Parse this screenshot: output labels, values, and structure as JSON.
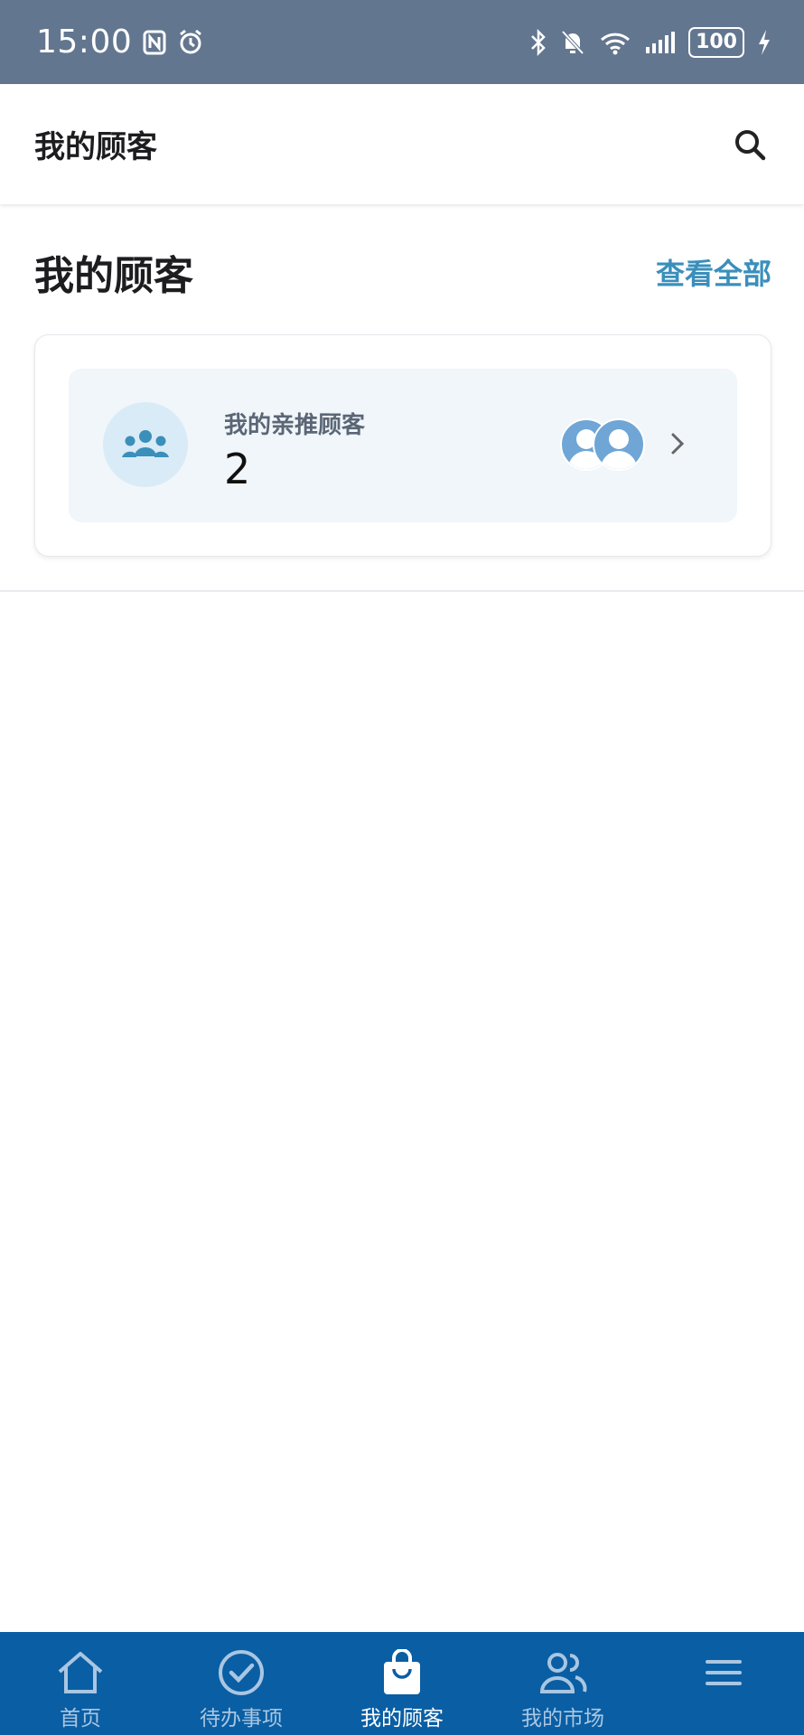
{
  "status_bar": {
    "time": "15:00",
    "battery": "100",
    "icons": [
      "nfc-icon",
      "alarm-icon",
      "bluetooth-icon",
      "mute-icon",
      "wifi-icon",
      "signal-icon",
      "battery-icon",
      "charging-icon"
    ]
  },
  "app_bar": {
    "title": "我的顾客",
    "search_icon": "search-icon"
  },
  "section": {
    "title": "我的顾客",
    "view_all": "查看全部"
  },
  "customer_card": {
    "label": "我的亲推顾客",
    "count": "2",
    "icon": "group-icon",
    "accent": "#3a8fbb"
  },
  "bottom_nav": {
    "items": [
      {
        "label": "首页",
        "icon": "home-icon"
      },
      {
        "label": "待办事项",
        "icon": "check-circle-icon"
      },
      {
        "label": "我的顾客",
        "icon": "shopping-bag-icon",
        "active": true
      },
      {
        "label": "我的市场",
        "icon": "people-icon"
      },
      {
        "label": "",
        "icon": "menu-icon"
      }
    ],
    "background": "#0a5ea3"
  }
}
